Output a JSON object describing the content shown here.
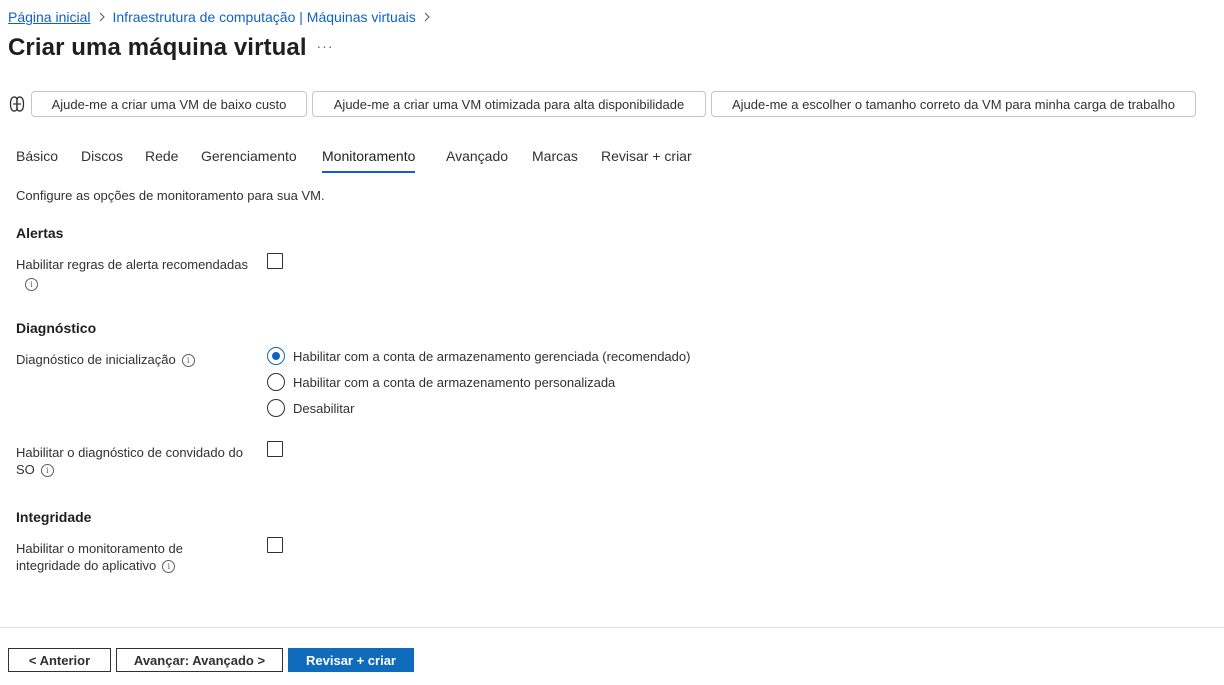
{
  "breadcrumb": {
    "items": [
      "Página inicial",
      "Infraestrutura de computação | Máquinas virtuais"
    ]
  },
  "page": {
    "title": "Criar uma máquina virtual",
    "more_label": "···"
  },
  "copilot": {
    "icon": "copilot-icon",
    "suggestions": [
      "Ajude-me a criar uma VM de baixo custo",
      "Ajude-me a criar uma VM otimizada para alta disponibilidade",
      "Ajude-me a escolher o tamanho correto da VM para minha carga de trabalho"
    ]
  },
  "tabs": [
    {
      "label": "Básico",
      "active": false
    },
    {
      "label": "Discos",
      "active": false
    },
    {
      "label": "Rede",
      "active": false
    },
    {
      "label": "Gerenciamento",
      "active": false
    },
    {
      "label": "Monitoramento",
      "active": true
    },
    {
      "label": "Avançado",
      "active": false
    },
    {
      "label": "Marcas",
      "active": false
    },
    {
      "label": "Revisar + criar",
      "active": false
    }
  ],
  "description": "Configure as opções de monitoramento para sua VM.",
  "alerts": {
    "heading": "Alertas",
    "enable_alert_rules_label": "Habilitar regras de alerta recomendadas",
    "enable_alert_rules_checked": false
  },
  "diagnostics": {
    "heading": "Diagnóstico",
    "boot_label": "Diagnóstico de inicialização",
    "boot_options": [
      {
        "label": "Habilitar com a conta de armazenamento gerenciada (recomendado)",
        "selected": true
      },
      {
        "label": "Habilitar com a conta de armazenamento personalizada",
        "selected": false
      },
      {
        "label": "Desabilitar",
        "selected": false
      }
    ],
    "guest_label": "Habilitar o diagnóstico de convidado do SO",
    "guest_checked": false
  },
  "health": {
    "heading": "Integridade",
    "app_health_label": "Habilitar o monitoramento de integridade do aplicativo",
    "app_health_checked": false
  },
  "footer": {
    "previous_label": "< Anterior",
    "next_label": "Avançar: Avançado >",
    "review_label": "Revisar + criar"
  },
  "colors": {
    "accent": "#0f6cbd",
    "link": "#0f62c5",
    "text": "#323130",
    "border": "#c8c6c4"
  }
}
